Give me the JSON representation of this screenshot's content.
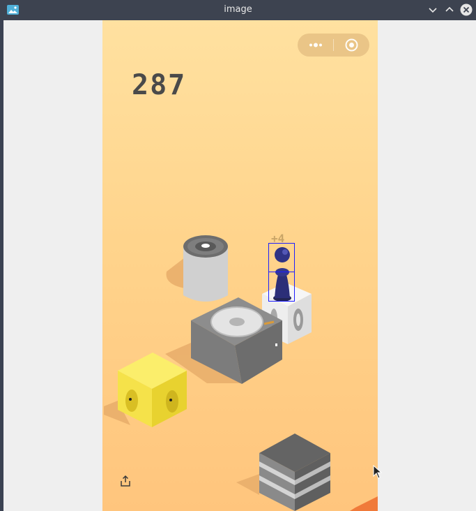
{
  "window": {
    "title": "image",
    "icons": {
      "app": "image-icon",
      "minimize": "chevron-down-icon",
      "maximize": "chevron-up-icon",
      "close": "close-icon"
    }
  },
  "game": {
    "score": "287",
    "bonus_popup": "+4",
    "menu_capsule": {
      "more": "more-dots-icon",
      "close": "target-circle-icon"
    },
    "share_icon": "share-icon",
    "colors": {
      "background_top": "#ffe1a0",
      "background_bottom": "#ffc57d",
      "score": "#4a4a4a",
      "bbox": "#1d1dff"
    }
  }
}
